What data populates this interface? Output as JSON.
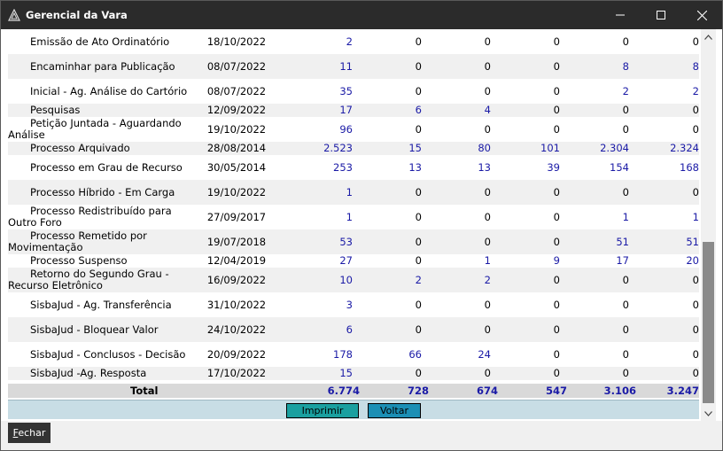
{
  "window": {
    "title": "Gerencial da Vara"
  },
  "rows": [
    {
      "name": "Emissão de Ato Ordinatório",
      "date": "18/10/2022",
      "v": [
        "2",
        "0",
        "0",
        "0",
        "0",
        "0"
      ]
    },
    {
      "name": "Encaminhar para Publicação",
      "date": "08/07/2022",
      "v": [
        "11",
        "0",
        "0",
        "0",
        "8",
        "8"
      ]
    },
    {
      "name": "Inicial - Ag. Análise do Cartório",
      "date": "08/07/2022",
      "v": [
        "35",
        "0",
        "0",
        "0",
        "2",
        "2"
      ]
    },
    {
      "name": "Pesquisas",
      "date": "12/09/2022",
      "v": [
        "17",
        "6",
        "4",
        "0",
        "0",
        "0"
      ]
    },
    {
      "name": "Petição Juntada - Aguardando Análise",
      "date": "19/10/2022",
      "v": [
        "96",
        "0",
        "0",
        "0",
        "0",
        "0"
      ]
    },
    {
      "name": "Processo Arquivado",
      "date": "28/08/2014",
      "v": [
        "2.523",
        "15",
        "80",
        "101",
        "2.304",
        "2.324"
      ]
    },
    {
      "name": "Processo em Grau de Recurso",
      "date": "30/05/2014",
      "v": [
        "253",
        "13",
        "13",
        "39",
        "154",
        "168"
      ]
    },
    {
      "name": "Processo Híbrido - Em Carga",
      "date": "19/10/2022",
      "v": [
        "1",
        "0",
        "0",
        "0",
        "0",
        "0"
      ]
    },
    {
      "name": "Processo Redistribuído para Outro Foro",
      "date": "27/09/2017",
      "v": [
        "1",
        "0",
        "0",
        "0",
        "1",
        "1"
      ]
    },
    {
      "name": "Processo Remetido por Movimentação",
      "date": "19/07/2018",
      "v": [
        "53",
        "0",
        "0",
        "0",
        "51",
        "51"
      ]
    },
    {
      "name": "Processo Suspenso",
      "date": "12/04/2019",
      "v": [
        "27",
        "0",
        "1",
        "9",
        "17",
        "20"
      ]
    },
    {
      "name": "Retorno do Segundo Grau - Recurso Eletrônico",
      "date": "16/09/2022",
      "v": [
        "10",
        "2",
        "2",
        "0",
        "0",
        "0"
      ]
    },
    {
      "name": "SisbaJud - Ag. Transferência",
      "date": "31/10/2022",
      "v": [
        "3",
        "0",
        "0",
        "0",
        "0",
        "0"
      ]
    },
    {
      "name": "SisbaJud - Bloquear Valor",
      "date": "24/10/2022",
      "v": [
        "6",
        "0",
        "0",
        "0",
        "0",
        "0"
      ]
    },
    {
      "name": "SisbaJud - Conclusos - Decisão",
      "date": "20/09/2022",
      "v": [
        "178",
        "66",
        "24",
        "0",
        "0",
        "0"
      ]
    },
    {
      "name": "SisbaJud -Ag. Resposta",
      "date": "17/10/2022",
      "v": [
        "15",
        "0",
        "0",
        "0",
        "0",
        "0"
      ]
    }
  ],
  "totals": {
    "label": "Total",
    "values": [
      "6.774",
      "728",
      "674",
      "547",
      "3.106",
      "3.247"
    ]
  },
  "buttons": {
    "print": "Imprimir",
    "back": "Voltar",
    "close_accel": "F",
    "close_rest": "echar"
  },
  "colors": {
    "link_blue": "#1a1aa6",
    "titlebar": "#2b2b2b",
    "print_button": "#1aa0a0",
    "back_button": "#1b8fb5"
  }
}
